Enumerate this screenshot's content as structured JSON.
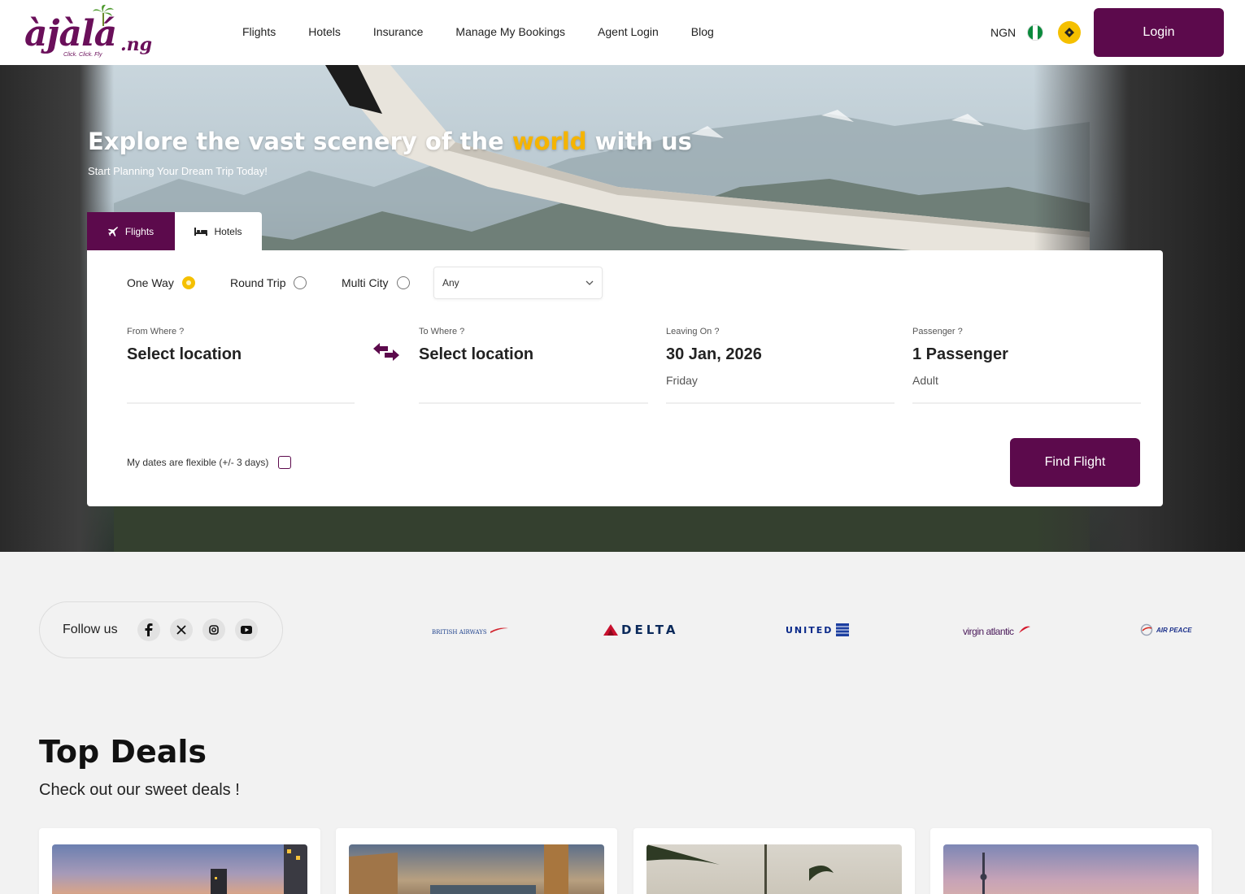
{
  "brand": {
    "logo_text": "àjàlá",
    "logo_tld": ".ng",
    "logo_tagline": "Click. Click. Fly"
  },
  "nav": {
    "items": [
      "Flights",
      "Hotels",
      "Insurance",
      "Manage My Bookings",
      "Agent Login",
      "Blog"
    ],
    "currency": "NGN",
    "login_label": "Login"
  },
  "hero": {
    "title_before": "Explore the vast scenery of the ",
    "title_accent": "world",
    "title_after": " with us",
    "subtitle": "Start Planning Your Dream Trip Today!"
  },
  "tabs": {
    "flights": "Flights",
    "hotels": "Hotels"
  },
  "search": {
    "trip_types": [
      {
        "label": "One Way",
        "checked": true
      },
      {
        "label": "Round Trip",
        "checked": false
      },
      {
        "label": "Multi City",
        "checked": false
      }
    ],
    "cabin_select": "Any",
    "from": {
      "label": "From Where ?",
      "value": "Select location"
    },
    "to": {
      "label": "To Where ?",
      "value": "Select location"
    },
    "date": {
      "label": "Leaving On ?",
      "value": "30 Jan, 2026",
      "sub": "Friday"
    },
    "passenger": {
      "label": "Passenger ?",
      "value": "1 Passenger",
      "sub": "Adult"
    },
    "flexible_label": "My dates are flexible (+/- 3 days)",
    "find_label": "Find Flight"
  },
  "social": {
    "label": "Follow us",
    "icons": [
      "facebook-icon",
      "x-icon",
      "instagram-icon",
      "youtube-icon"
    ]
  },
  "airlines": {
    "british": "BRITISH AIRWAYS",
    "delta": "DELTA",
    "united": "UNITED",
    "virgin": "virgin atlantic",
    "airpeace": "AIR PEACE"
  },
  "deals": {
    "title": "Top Deals",
    "subtitle": "Check out our sweet deals !"
  },
  "colors": {
    "brand": "#5c0a4c",
    "accent": "#f5c000",
    "flag_green": "#0a8a3c"
  }
}
